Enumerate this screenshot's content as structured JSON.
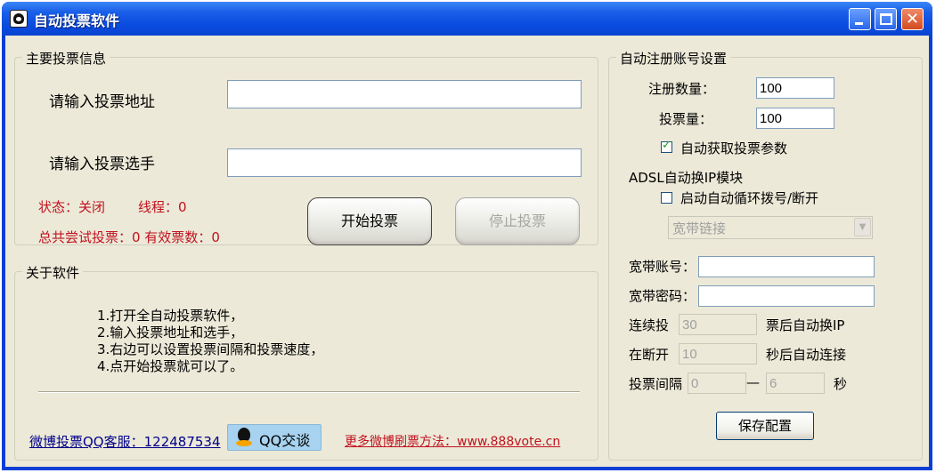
{
  "window": {
    "title": "自动投票软件",
    "close_glyph": "✕"
  },
  "main_info": {
    "legend": "主要投票信息",
    "url_label": "请输入投票地址",
    "url_value": "",
    "player_label": "请输入投票选手",
    "player_value": "",
    "status_text": "状态：关闭",
    "thread_text": "线程：0",
    "totals_text": "总共尝试投票：0 有效票数：0",
    "start_button": "开始投票",
    "stop_button": "停止投票"
  },
  "about": {
    "legend": "关于软件",
    "lines": [
      "1.打开全自动投票软件，",
      "2.输入投票地址和选手，",
      "3.右边可以设置投票间隔和投票速度，",
      "4.点开始投票就可以了。"
    ],
    "support_link": "微博投票QQ客服：122487534",
    "qq_button": "QQ交谈",
    "more_link": "更多微博刷票方法：www.888vote.cn"
  },
  "register": {
    "legend": "自动注册账号设置",
    "count_label": "注册数量：",
    "count_value": "100",
    "votes_label": "投票量：",
    "votes_value": "100",
    "auto_params_label": "自动获取投票参数",
    "auto_params_checked": true,
    "adsl_title": "ADSL自动换IP模块",
    "auto_dial_label": "启动自动循环拨号/断开",
    "auto_dial_checked": false,
    "connection_select": "宽带链接",
    "account_label": "宽带账号：",
    "account_value": "",
    "password_label": "宽带密码：",
    "password_value": "",
    "continuous_label": "连续投",
    "continuous_value": "30",
    "continuous_suffix": "票后自动换IP",
    "reconnect_label": "在断开",
    "reconnect_value": "10",
    "reconnect_suffix": "秒后自动连接",
    "interval_label": "投票间隔",
    "interval_min": "0",
    "interval_dash": "—",
    "interval_max": "6",
    "interval_unit": "秒",
    "save_button": "保存配置"
  },
  "colors": {
    "accent_red": "#c1121f",
    "link_blue": "#00008b",
    "titlebar_blue": "#0a4be0",
    "client_bg": "#ece9d8"
  }
}
